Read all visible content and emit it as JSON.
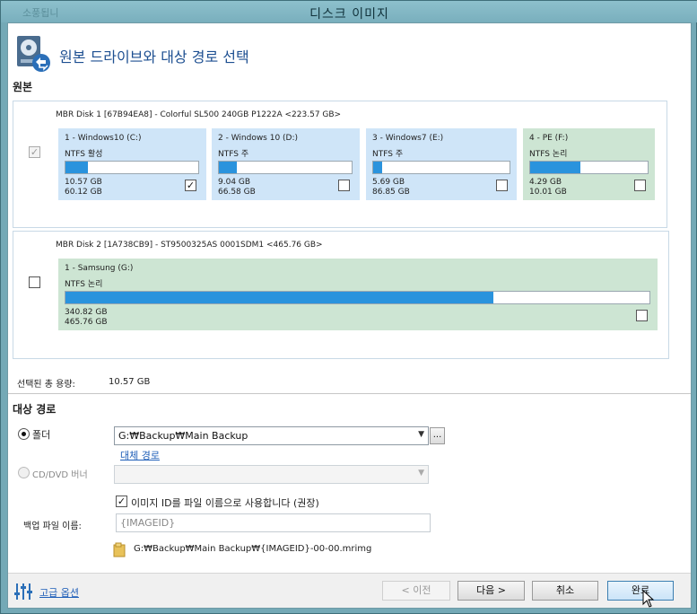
{
  "window": {
    "title": "디스크 이미지",
    "bg_title_fragment": "소풍됩니"
  },
  "header": {
    "title": "원본 드라이브와 대상 경로 선택"
  },
  "source": {
    "label": "원본",
    "disks": [
      {
        "title": "MBR Disk 1 [67B94EA8] - Colorful SL500 240GB P1222A   <223.57 GB>",
        "checked": "✓",
        "partitions": [
          {
            "name": "1 - Windows10 (C:)",
            "fs": "NTFS 활성",
            "used": "10.57 GB",
            "total": "60.12 GB",
            "fill": 0.17,
            "checked": "✓"
          },
          {
            "name": "2 - Windows 10 (D:)",
            "fs": "NTFS 주",
            "used": "9.04 GB",
            "total": "66.58 GB",
            "fill": 0.135,
            "checked": ""
          },
          {
            "name": "3 - Windows7 (E:)",
            "fs": "NTFS 주",
            "used": "5.69 GB",
            "total": "86.85 GB",
            "fill": 0.065,
            "checked": ""
          },
          {
            "name": "4 - PE (F:)",
            "fs": "NTFS 논리",
            "used": "4.29 GB",
            "total": "10.01 GB",
            "fill": 0.43,
            "checked": ""
          }
        ]
      },
      {
        "title": "MBR Disk 2 [1A738CB9] - ST9500325AS 0001SDM1   <465.76 GB>",
        "checked": "",
        "partitions": [
          {
            "name": "1 - Samsung (G:)",
            "fs": "NTFS 논리",
            "used": "340.82 GB",
            "total": "465.76 GB",
            "fill": 0.732,
            "checked": ""
          }
        ]
      }
    ],
    "selected_label": "선택된 총 용량:",
    "selected_value": "10.57 GB"
  },
  "destination": {
    "label": "대상 경로",
    "folder_label": "폴더",
    "folder_value": "G:₩Backup₩Main Backup",
    "browse_label": "...",
    "alt_path_link": "대체 경로",
    "cddvd_label": "CD/DVD 버너",
    "cddvd_value": "",
    "use_id_checked": "✓",
    "use_id_label": "이미지 ID를 파일 이름으로 사용합니다 (권장)",
    "filename_label": "백업 파일 이름:",
    "filename_placeholder": "{IMAGEID}",
    "result_path": "G:₩Backup₩Main Backup₩{IMAGEID}-00-00.mrimg"
  },
  "footer": {
    "advanced_link": "고급 옵션",
    "prev_button": "< 이전",
    "next_button": "다음 >",
    "cancel_button": "취소",
    "finish_button": "완료"
  },
  "colors": {
    "partition_blue": "#cfe5f8",
    "partition_green": "#cde5d3",
    "usage_bar": "#2a93dd",
    "heading_blue": "#1d4f91"
  },
  "icons": [
    "disk-image-icon",
    "folder-icon",
    "advanced-options-icon",
    "cursor-icon"
  ]
}
